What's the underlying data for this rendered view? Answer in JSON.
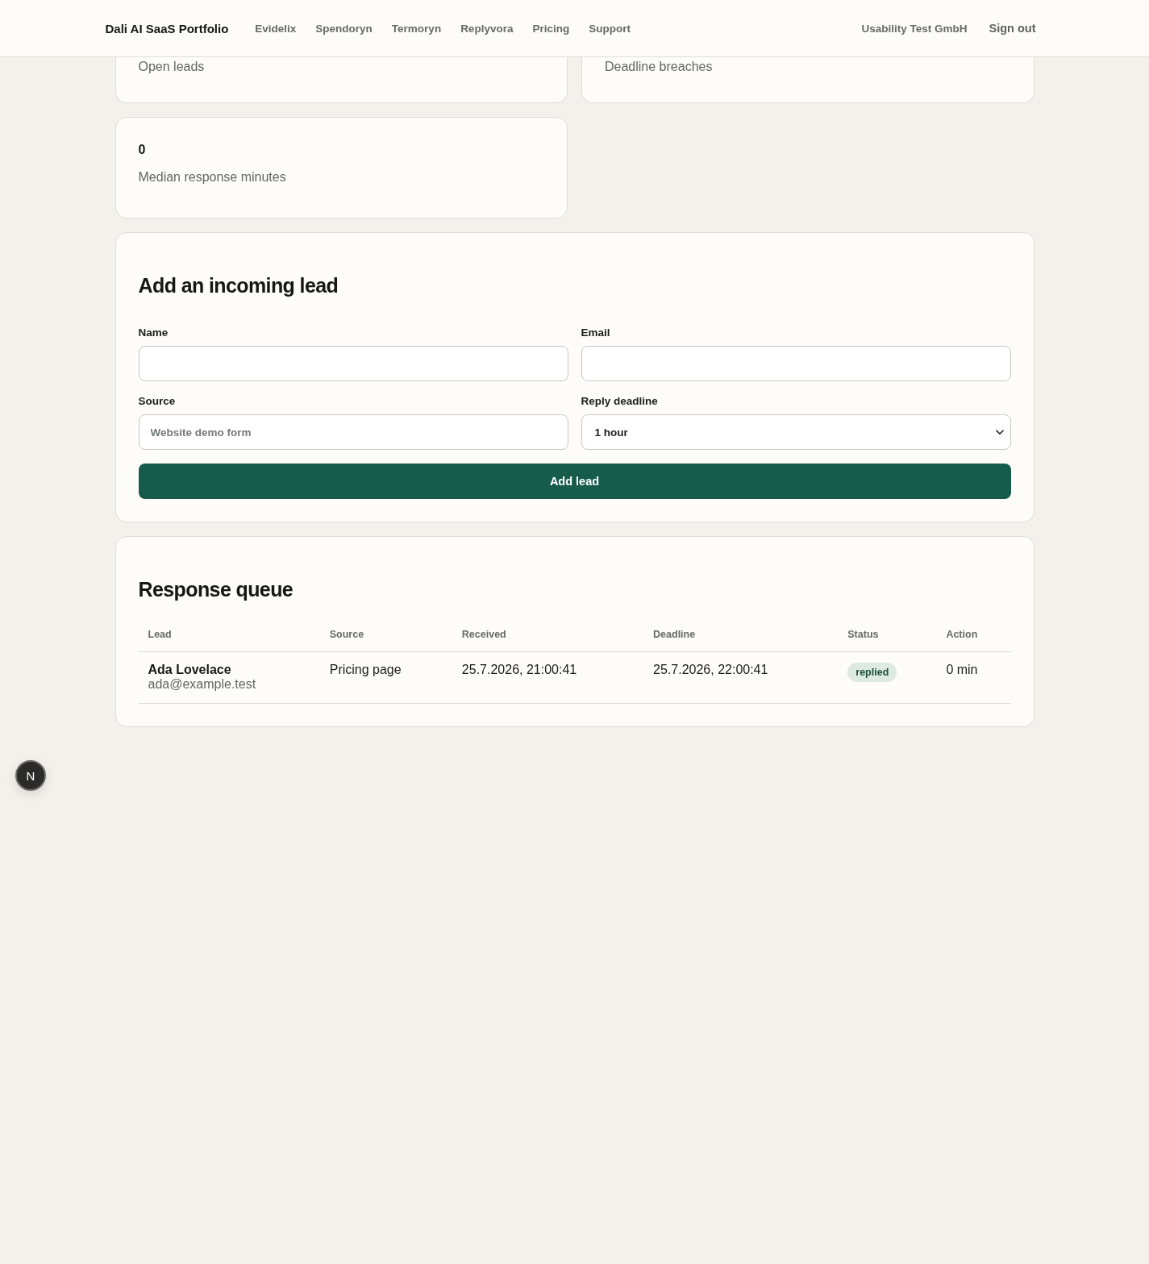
{
  "header": {
    "brand": "Dali AI SaaS Portfolio",
    "nav": [
      "Evidelix",
      "Spendoryn",
      "Termoryn",
      "Replyvora",
      "Pricing",
      "Support"
    ],
    "organization": "Usability Test GmbH",
    "sign_out": "Sign out"
  },
  "stats": [
    {
      "label": "Open leads"
    },
    {
      "label": "Deadline breaches"
    },
    {
      "value": "0",
      "label": "Median response minutes"
    }
  ],
  "lead_form": {
    "title": "Add an incoming lead",
    "fields": [
      {
        "kind": "text",
        "label": "Name"
      },
      {
        "kind": "text",
        "label": "Email"
      },
      {
        "kind": "text",
        "label": "Source",
        "placeholder": "Website demo form"
      },
      {
        "kind": "select",
        "label": "Reply deadline",
        "value": "1 hour"
      }
    ],
    "submit": "Add lead"
  },
  "queue": {
    "title": "Response queue",
    "columns": [
      "Lead",
      "Source",
      "Received",
      "Deadline",
      "Status",
      "Action"
    ],
    "rows": [
      {
        "name": "Ada Lovelace",
        "email": "ada@example.test",
        "source": "Pricing page",
        "received": "25.7.2026, 21:00:41",
        "deadline": "25.7.2026, 22:00:41",
        "status": "replied",
        "action": "0 min"
      }
    ]
  },
  "dev_badge": {
    "label": "N"
  }
}
